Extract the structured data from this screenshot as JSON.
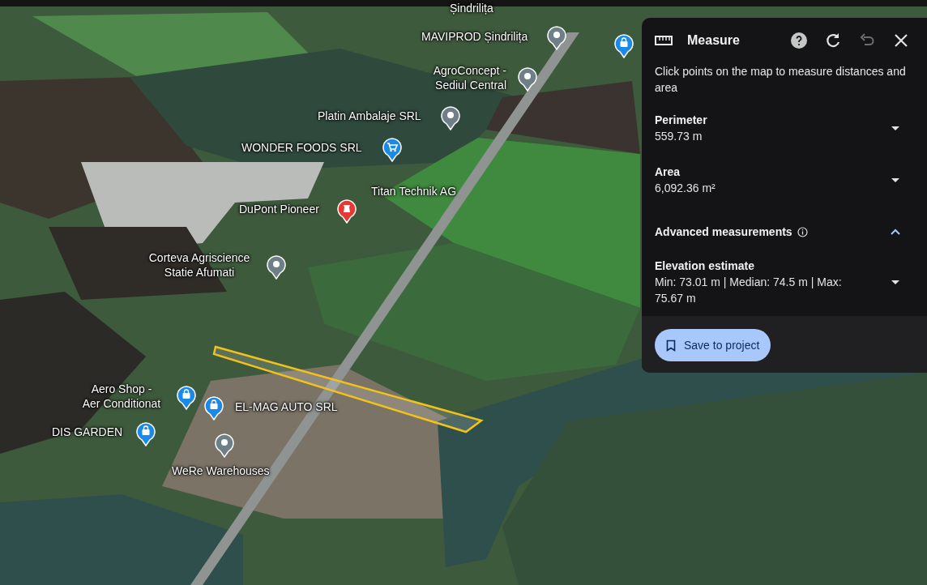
{
  "map": {
    "places": [
      {
        "label": "Șindrilița",
        "kind": "label"
      },
      {
        "label": "MAVIPROD Șindrilița",
        "kind": "place"
      },
      {
        "kind": "shop"
      },
      {
        "label": "AgroConcept -\nSediul Central",
        "kind": "place"
      },
      {
        "label": "Platin Ambalaje SRL",
        "kind": "place"
      },
      {
        "label": "WONDER FOODS SRL",
        "kind": "cart"
      },
      {
        "label": "Titan Technik AG",
        "kind": "label"
      },
      {
        "label": "DuPont Pioneer",
        "kind": "landmark"
      },
      {
        "label": "Corteva Agriscience\nStatie Afumati",
        "kind": "place"
      },
      {
        "label": "Aero Shop -\nAer Conditionat",
        "kind": "shop"
      },
      {
        "label": "EL-MAG AUTO SRL",
        "kind": "shop"
      },
      {
        "label": "DIS GARDEN",
        "kind": "shop"
      },
      {
        "label": "WeRe Warehouses",
        "kind": "place"
      }
    ]
  },
  "panel": {
    "title": "Measure",
    "tools": [
      {
        "kind": "help",
        "disabled": false
      },
      {
        "kind": "refresh",
        "disabled": false
      },
      {
        "kind": "undo",
        "disabled": true
      },
      {
        "kind": "close",
        "disabled": false
      }
    ],
    "description": "Click points on the map to measure distances and area",
    "measurements": [
      {
        "label": "Perimeter",
        "value": "559.73 m",
        "expanded": false
      },
      {
        "label": "Area",
        "value": "6,092.36 m²",
        "expanded": false
      }
    ],
    "advanced": {
      "label": "Advanced measurements",
      "expanded": true,
      "items": [
        {
          "label": "Elevation estimate",
          "value": "Min: 73.01 m | Median: 74.5 m | Max: 75.67 m",
          "expanded": false
        }
      ]
    },
    "save_button": "Save to project"
  }
}
